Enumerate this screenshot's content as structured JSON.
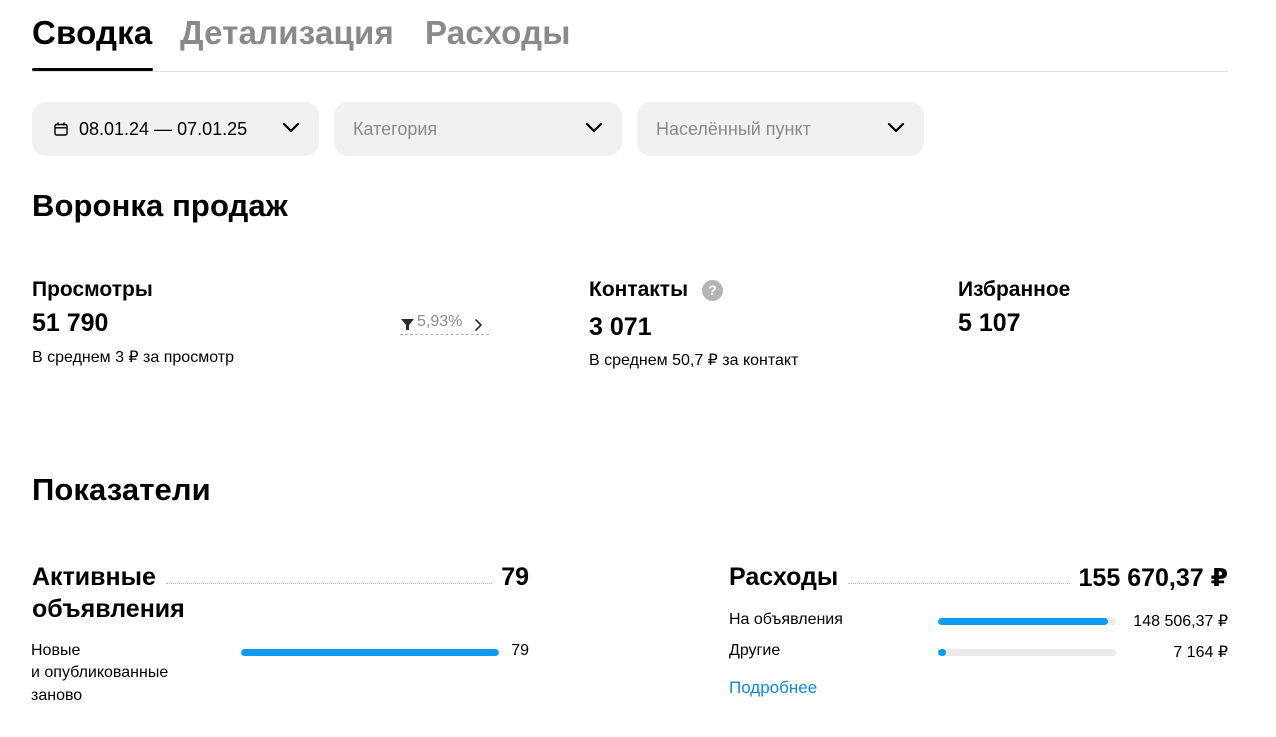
{
  "tabs": [
    {
      "label": "Сводка",
      "active": true
    },
    {
      "label": "Детализация",
      "active": false
    },
    {
      "label": "Расходы",
      "active": false
    }
  ],
  "filters": {
    "date_range": "08.01.24 — 07.01.25",
    "category_placeholder": "Категория",
    "location_placeholder": "Населённый пункт"
  },
  "funnel": {
    "title": "Воронка продаж",
    "views": {
      "label": "Просмотры",
      "value": "51 790",
      "sub": "В среднем 3 ₽ за просмотр"
    },
    "conversion": "5,93%",
    "contacts": {
      "label": "Контакты",
      "help": "?",
      "value": "3 071",
      "sub": "В среднем 50,7 ₽ за контакт"
    },
    "favorites": {
      "label": "Избранное",
      "value": "5 107"
    }
  },
  "indicators": {
    "title": "Показатели",
    "active_ads": {
      "title_line1": "Активные",
      "title_line2": "объявления",
      "value": "79",
      "rows": [
        {
          "label_lines": [
            "Новые",
            "и опубликованные",
            "заново"
          ],
          "value": "79",
          "fraction": 1.0
        }
      ]
    },
    "expenses": {
      "title": "Расходы",
      "value": "155 670,37 ₽",
      "rows": [
        {
          "label": "На объявления",
          "value": "148 506,37 ₽",
          "fraction": 0.954
        },
        {
          "label": "Другие",
          "value": "7 164 ₽",
          "fraction": 0.046
        }
      ],
      "more_link": "Подробнее"
    }
  },
  "colors": {
    "bar": "#0d9bf0",
    "track": "#ebebeb",
    "link": "#0d8ae0",
    "muted": "#8a8a8a"
  }
}
